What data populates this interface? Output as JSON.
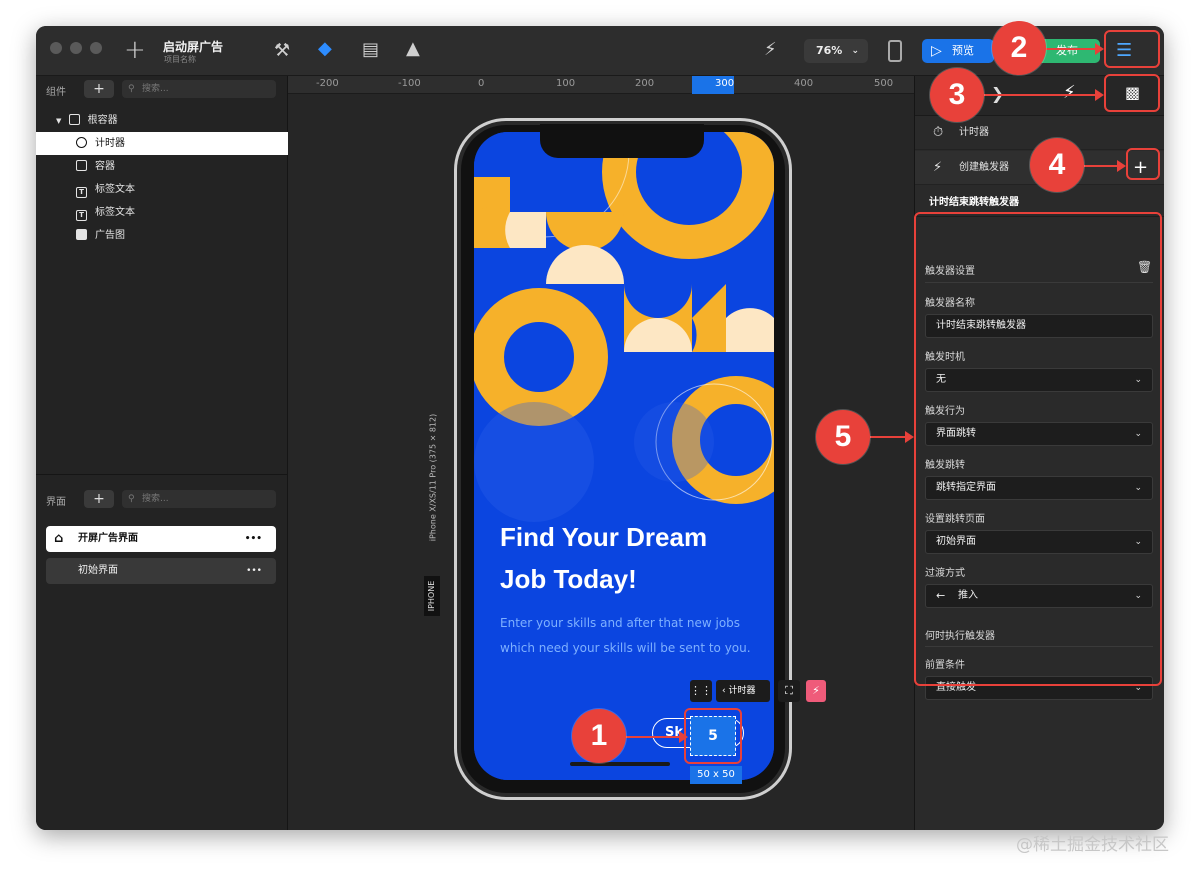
{
  "app": {
    "title": "启动屏广告",
    "subtitle": "项目名称",
    "zoom": "76%",
    "preview_label": "预览",
    "publish_label": "发布"
  },
  "components": {
    "header": "组件",
    "search_placeholder": "搜索...",
    "tree": [
      {
        "label": "根容器",
        "icon": "square-icon"
      },
      {
        "label": "计时器",
        "icon": "timer-icon"
      },
      {
        "label": "容器",
        "icon": "square-icon"
      },
      {
        "label": "标签文本",
        "icon": "text-icon"
      },
      {
        "label": "标签文本",
        "icon": "text-icon"
      },
      {
        "label": "广告图",
        "icon": "image-icon"
      }
    ]
  },
  "screens": {
    "header": "界面",
    "search_placeholder": "搜索...",
    "items": [
      {
        "label": "开屏广告界面",
        "more": "•••"
      },
      {
        "label": "初始界面",
        "more": "•••"
      }
    ]
  },
  "ruler": {
    "ticks": [
      "-200",
      "-100",
      "0",
      "100",
      "200",
      "300",
      "400",
      "500"
    ]
  },
  "device": {
    "label": "iPhone X/XS/11 Pro (375 × 812)",
    "type": "IPHONE",
    "headline_1": "Find Your Dream",
    "headline_2": "Job Today!",
    "body_1": "Enter your skills and after that new jobs",
    "body_2": "which need your skills will be sent to you.",
    "skip_label": "Sk",
    "timer_value": "5",
    "selection_size": "50 x 50",
    "toolbar_timer_label": "计时器"
  },
  "inspector": {
    "timer_label": "计时器",
    "create_trigger_label": "创建触发器",
    "trigger_title": "计时结束跳转触发器",
    "settings_header": "触发器设置",
    "fields": [
      {
        "label": "触发器名称",
        "value": "计时结束跳转触发器",
        "select": false
      },
      {
        "label": "触发时机",
        "value": "无",
        "select": true
      },
      {
        "label": "触发行为",
        "value": "界面跳转",
        "select": true
      },
      {
        "label": "触发跳转",
        "value": "跳转指定界面",
        "select": true
      },
      {
        "label": "设置跳转页面",
        "value": "初始界面",
        "select": true
      },
      {
        "label": "过渡方式",
        "value": "推入",
        "select": true
      }
    ],
    "when_header": "何时执行触发器",
    "precondition_label": "前置条件",
    "precondition_value": "直接触发"
  },
  "callouts": [
    "1",
    "2",
    "3",
    "4",
    "5"
  ],
  "watermark": "@稀土掘金技术社区",
  "colors": {
    "accent_blue": "#1a73e8",
    "publish_green": "#2eb872",
    "callout_red": "#e8413a",
    "screen_blue": "#0b45e0",
    "shape_yellow": "#f6b12a",
    "shape_cream": "#fde7c4"
  }
}
